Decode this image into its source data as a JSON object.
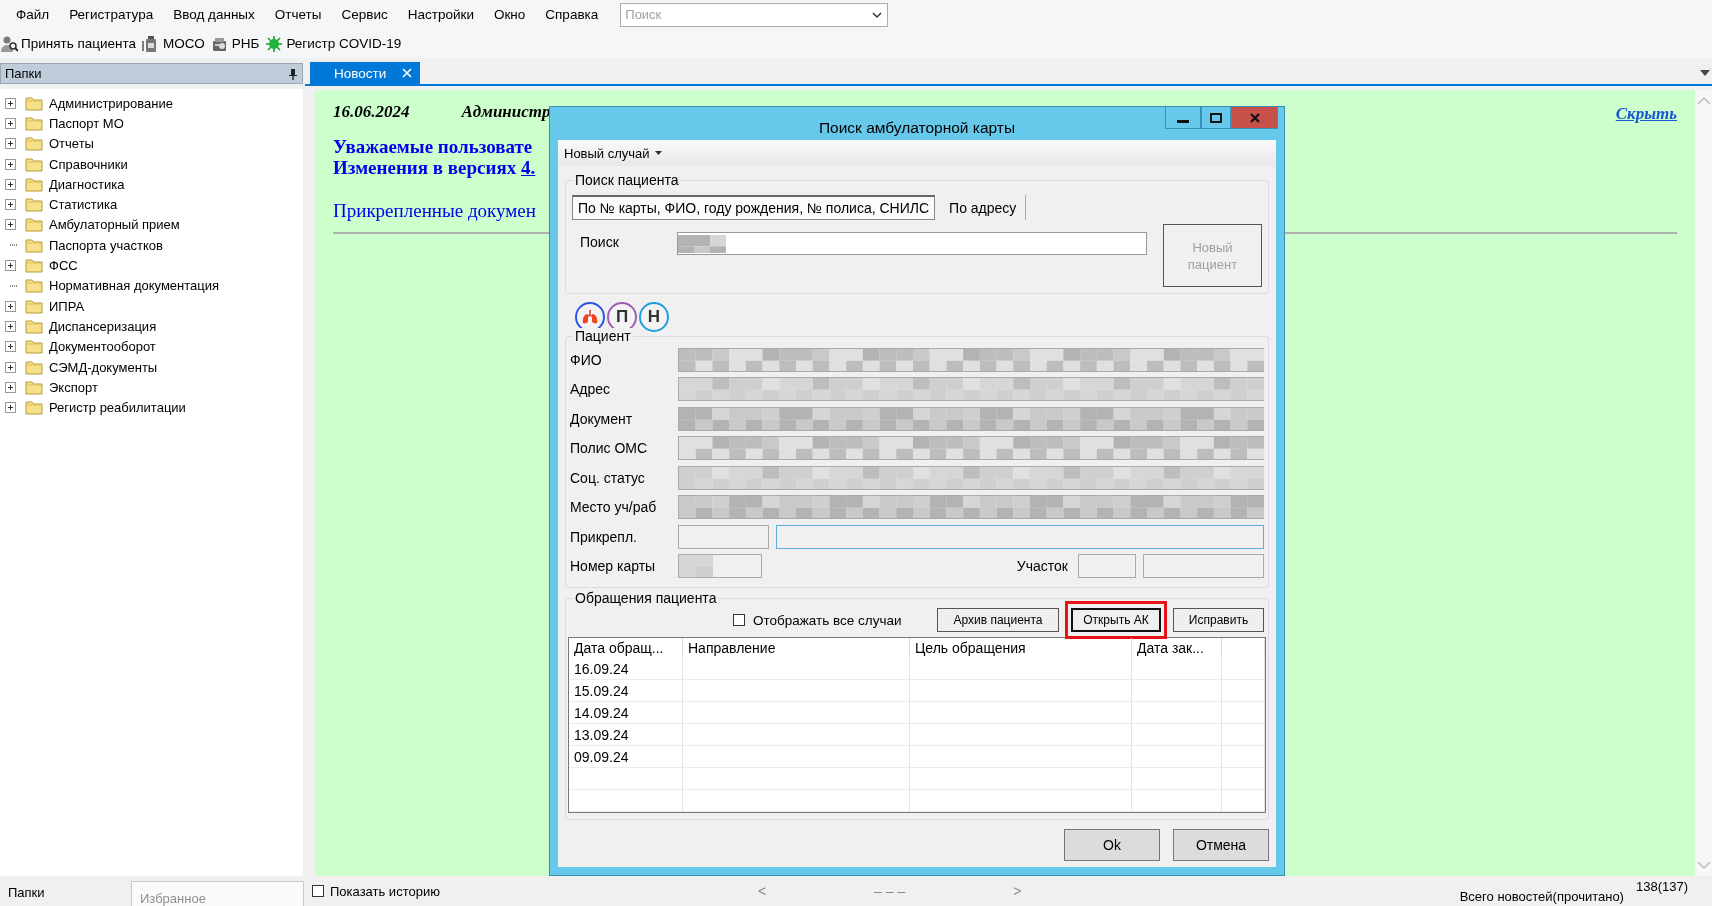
{
  "menu_bar": {
    "items": [
      "Файл",
      "Регистратура",
      "Ввод данных",
      "Отчеты",
      "Сервис",
      "Настройки",
      "Окно",
      "Справка"
    ],
    "search": {
      "placeholder": "Поиск"
    }
  },
  "toolbar": {
    "items": [
      {
        "kind": "patient",
        "label": "Принять пациента"
      },
      {
        "kind": "bottle",
        "label": "МОСО"
      },
      {
        "kind": "scanner",
        "label": "РНБ"
      },
      {
        "kind": "virus",
        "label": "Регистр COVID-19"
      }
    ]
  },
  "sidebar": {
    "title": "Папки",
    "items": [
      {
        "label": "Администрирование",
        "expandable": true
      },
      {
        "label": "Паспорт МО",
        "expandable": true
      },
      {
        "label": "Отчеты",
        "expandable": true
      },
      {
        "label": "Справочники",
        "expandable": true
      },
      {
        "label": "Диагностика",
        "expandable": true
      },
      {
        "label": "Статистика",
        "expandable": true
      },
      {
        "label": "Амбулаторный прием",
        "expandable": true
      },
      {
        "label": "Паспорта участков",
        "expandable": false
      },
      {
        "label": "ФСС",
        "expandable": true
      },
      {
        "label": "Нормативная документация",
        "expandable": false
      },
      {
        "label": "ИПРА",
        "expandable": true
      },
      {
        "label": "Диспансеризация",
        "expandable": true
      },
      {
        "label": "Документооборот",
        "expandable": true
      },
      {
        "label": "СЭМД-документы",
        "expandable": true
      },
      {
        "label": "Экспорт",
        "expandable": true
      },
      {
        "label": "Регистр реабилитации",
        "expandable": true
      }
    ],
    "tabs": [
      {
        "label": "Папки",
        "selected": true
      },
      {
        "label": "Избранное",
        "selected": false
      }
    ]
  },
  "tabs": [
    {
      "label": "Новости",
      "selected": true
    }
  ],
  "news": {
    "date": "16.06.2024",
    "author": "Администр",
    "headline": "Уважаемые пользовате",
    "changes_text": "Изменения в версиях",
    "changes_link": "4.",
    "attachments": "Прикрепленные докумен",
    "hide_link": "Скрыть"
  },
  "dialog": {
    "title": "Поиск амбулаторной карты",
    "menu": "Новый случай",
    "search_group": {
      "title": "Поиск пациента",
      "tabs": [
        {
          "label": "По № карты, ФИО, году рождения, № полиса, СНИЛС",
          "selected": true
        },
        {
          "label": "По адресу",
          "selected": false
        }
      ],
      "search_label": "Поиск",
      "search_redacted": true,
      "new_patient": {
        "label": "Новый пациент",
        "disabled": true
      }
    },
    "badges": [
      {
        "kind": "lungs",
        "color": "#2f55e8"
      },
      {
        "kind": "letter",
        "label": "П",
        "color": "#a05cb4"
      },
      {
        "kind": "letter",
        "label": "Н",
        "color": "#1ea0e0"
      }
    ],
    "patient_group": {
      "title": "Пациент",
      "fields": [
        {
          "label": "ФИО",
          "redacted": true
        },
        {
          "label": "Адрес",
          "redacted": true
        },
        {
          "label": "Документ",
          "redacted": true
        },
        {
          "label": "Полис ОМС",
          "redacted": true
        },
        {
          "label": "Соц. статус",
          "redacted": true
        },
        {
          "label": "Место уч/раб",
          "redacted": true
        }
      ],
      "attach": {
        "label": "Прикрепл.",
        "focused": true
      },
      "card_number": {
        "label": "Номер карты",
        "redacted": true
      },
      "district": {
        "label": "Участок"
      }
    },
    "visits_group": {
      "title": "Обращения пациента",
      "show_all": {
        "label": "Отображать все случаи",
        "checked": false
      },
      "buttons": [
        {
          "label": "Архив пациента",
          "highlighted": false
        },
        {
          "label": "Открыть АК",
          "highlighted": true
        },
        {
          "label": "Исправить",
          "highlighted": false
        }
      ],
      "table": {
        "columns": [
          "Дата обращ...",
          "Направление",
          "Цель обращения",
          "Дата зак..."
        ],
        "rows": [
          {
            "date": "16.09.24"
          },
          {
            "date": "15.09.24"
          },
          {
            "date": "14.09.24"
          },
          {
            "date": "13.09.24"
          },
          {
            "date": "09.09.24"
          }
        ]
      }
    },
    "buttons": [
      "Ok",
      "Отмена"
    ]
  },
  "status_bar": {
    "history": {
      "label": "Показать историю",
      "checked": false
    },
    "prev": "<",
    "page": "– – –",
    "next": ">",
    "counter_label": "Всего новостей(прочитано)",
    "counter": "138(137)"
  }
}
